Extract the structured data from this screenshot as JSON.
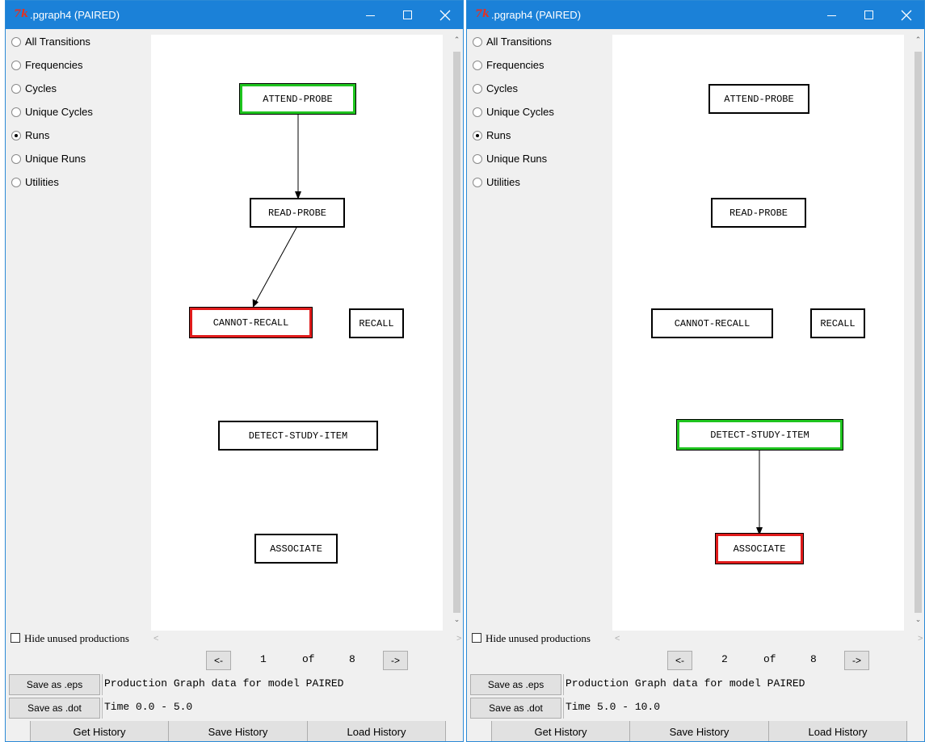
{
  "windows": [
    {
      "title": ".pgraph4 (PAIRED)",
      "options": [
        {
          "label": "All Transitions",
          "checked": false
        },
        {
          "label": "Frequencies",
          "checked": false
        },
        {
          "label": "Cycles",
          "checked": false
        },
        {
          "label": "Unique Cycles",
          "checked": false
        },
        {
          "label": "Runs",
          "checked": true
        },
        {
          "label": "Unique Runs",
          "checked": false
        },
        {
          "label": "Utilities",
          "checked": false
        }
      ],
      "nodes": {
        "attend_probe": {
          "label": "ATTEND-PROBE",
          "highlight": "green"
        },
        "read_probe": {
          "label": "READ-PROBE",
          "highlight": "none"
        },
        "cannot_recall": {
          "label": "CANNOT-RECALL",
          "highlight": "red"
        },
        "recall": {
          "label": "RECALL",
          "highlight": "none"
        },
        "detect_study_item": {
          "label": "DETECT-STUDY-ITEM",
          "highlight": "none"
        },
        "associate": {
          "label": "ASSOCIATE",
          "highlight": "none"
        }
      },
      "edges": [
        {
          "from": "ATTEND-PROBE",
          "to": "READ-PROBE"
        },
        {
          "from": "READ-PROBE",
          "to": "CANNOT-RECALL"
        }
      ],
      "hide_unused_label": "Hide unused productions",
      "hide_unused_checked": false,
      "nav": {
        "prev": "<-",
        "current": "1",
        "of": "of",
        "total": "8",
        "next": "->"
      },
      "save_eps": "Save as .eps",
      "save_dot": "Save as .dot",
      "info_line": "Production Graph data for model PAIRED",
      "time_line": "Time 0.0 - 5.0",
      "history": {
        "get": "Get History",
        "save": "Save History",
        "load": "Load History"
      }
    },
    {
      "title": ".pgraph4 (PAIRED)",
      "options": [
        {
          "label": "All Transitions",
          "checked": false
        },
        {
          "label": "Frequencies",
          "checked": false
        },
        {
          "label": "Cycles",
          "checked": false
        },
        {
          "label": "Unique Cycles",
          "checked": false
        },
        {
          "label": "Runs",
          "checked": true
        },
        {
          "label": "Unique Runs",
          "checked": false
        },
        {
          "label": "Utilities",
          "checked": false
        }
      ],
      "nodes": {
        "attend_probe": {
          "label": "ATTEND-PROBE",
          "highlight": "none"
        },
        "read_probe": {
          "label": "READ-PROBE",
          "highlight": "none"
        },
        "cannot_recall": {
          "label": "CANNOT-RECALL",
          "highlight": "none"
        },
        "recall": {
          "label": "RECALL",
          "highlight": "none"
        },
        "detect_study_item": {
          "label": "DETECT-STUDY-ITEM",
          "highlight": "green"
        },
        "associate": {
          "label": "ASSOCIATE",
          "highlight": "red"
        }
      },
      "edges": [
        {
          "from": "DETECT-STUDY-ITEM",
          "to": "ASSOCIATE"
        }
      ],
      "hide_unused_label": "Hide unused productions",
      "hide_unused_checked": false,
      "nav": {
        "prev": "<-",
        "current": "2",
        "of": "of",
        "total": "8",
        "next": "->"
      },
      "save_eps": "Save as .eps",
      "save_dot": "Save as .dot",
      "info_line": "Production Graph data for model PAIRED",
      "time_line": "Time 5.0 - 10.0",
      "history": {
        "get": "Get History",
        "save": "Save History",
        "load": "Load History"
      }
    }
  ],
  "colors": {
    "titlebar": "#1b81d8",
    "start_node": "#1fc41f",
    "end_node": "#e01b1b"
  },
  "icons": {
    "app": "tk-feather-icon",
    "minimize": "minimize-icon",
    "maximize": "maximize-icon",
    "close": "close-icon"
  }
}
